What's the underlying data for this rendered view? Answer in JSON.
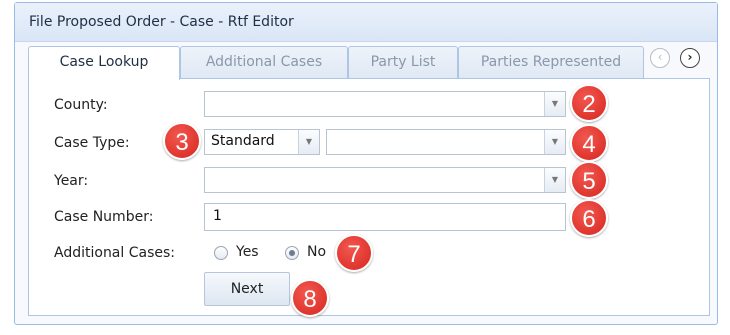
{
  "window": {
    "title": "File Proposed Order - Case - Rtf Editor"
  },
  "tabs": [
    {
      "label": "Case Lookup"
    },
    {
      "label": "Additional Cases"
    },
    {
      "label": "Party List"
    },
    {
      "label": "Parties Represented"
    }
  ],
  "form": {
    "county_label": "County:",
    "county_value": "",
    "case_type_label": "Case Type:",
    "case_type_value": "Standard",
    "case_subtype_value": "",
    "year_label": "Year:",
    "year_value": "",
    "case_number_label": "Case Number:",
    "case_number_value": "1",
    "additional_cases_label": "Additional Cases:",
    "options": {
      "yes": "Yes",
      "no": "No"
    },
    "selected_option": "No"
  },
  "next_button": "Next",
  "callouts": [
    "2",
    "3",
    "4",
    "5",
    "6",
    "7",
    "8"
  ],
  "icons": {
    "dropdown": "chevron-down-icon",
    "scroll_left": "chevron-left-icon",
    "scroll_right": "chevron-right-icon"
  },
  "colors": {
    "callout": "#e2342c",
    "border": "#99bbe8"
  }
}
